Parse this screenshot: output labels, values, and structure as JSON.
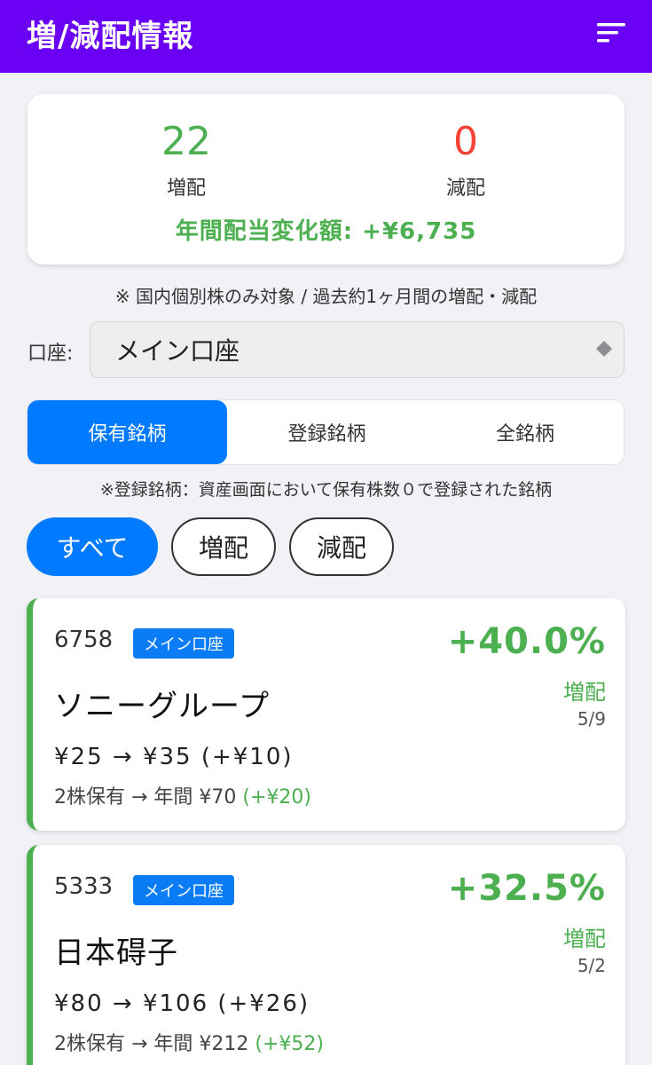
{
  "header": {
    "title": "増/減配情報",
    "menu_icon": "sort-menu-icon"
  },
  "summary": {
    "increase_count": "22",
    "increase_label": "増配",
    "decrease_count": "0",
    "decrease_label": "減配",
    "annual_change_label": "年間配当変化額:",
    "annual_change_value": "+¥6,735"
  },
  "note_scope": "※ 国内個別株のみ対象 / 過去約1ヶ月間の増配・減配",
  "account": {
    "label": "口座:",
    "selected": "メイン口座"
  },
  "segment_tabs": [
    {
      "label": "保有銘柄",
      "active": true
    },
    {
      "label": "登録銘柄",
      "active": false
    },
    {
      "label": "全銘柄",
      "active": false
    }
  ],
  "note_registered": "※登録銘柄：資産画面において保有株数０で登録された銘柄",
  "filter_chips": [
    {
      "label": "すべて",
      "active": true
    },
    {
      "label": "増配",
      "active": false
    },
    {
      "label": "減配",
      "active": false
    }
  ],
  "stocks": [
    {
      "code": "6758",
      "account_badge": "メイン口座",
      "name": "ソニーグループ",
      "rate": "+40.0%",
      "type": "増配",
      "date": "5/9",
      "dividend_change": "¥25 → ¥35 (+¥10)",
      "holding_text": "2株保有 → 年間 ¥70",
      "holding_diff": "(+¥20)"
    },
    {
      "code": "5333",
      "account_badge": "メイン口座",
      "name": "日本碍子",
      "rate": "+32.5%",
      "type": "増配",
      "date": "5/2",
      "dividend_change": "¥80 → ¥106 (+¥26)",
      "holding_text": "2株保有 → 年間 ¥212",
      "holding_diff": "(+¥52)"
    }
  ],
  "colors": {
    "appbar": "#6a00f4",
    "accent_blue": "#007aff",
    "increase_green": "#4caf50",
    "decrease_red": "#f44336"
  }
}
